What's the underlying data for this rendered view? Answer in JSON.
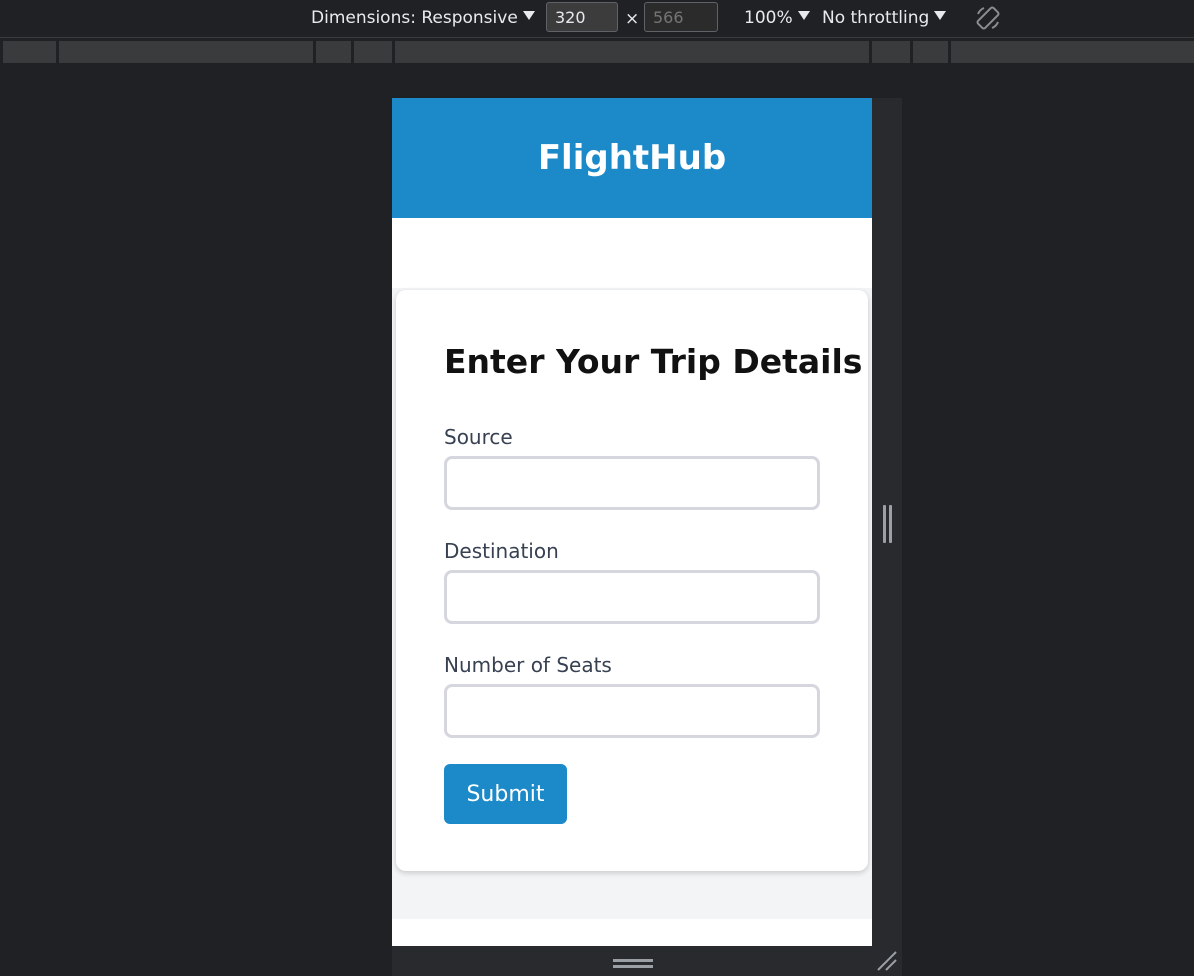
{
  "devtools": {
    "dimensions_label": "Dimensions: Responsive",
    "width_value": "320",
    "height_value": "566",
    "times_symbol": "×",
    "zoom": "100%",
    "throttling": "No throttling"
  },
  "app": {
    "title": "FlightHub",
    "form": {
      "heading": "Enter Your Trip Details",
      "fields": [
        {
          "label": "Source",
          "value": ""
        },
        {
          "label": "Destination",
          "value": ""
        },
        {
          "label": "Number of Seats",
          "value": ""
        }
      ],
      "submit_label": "Submit"
    }
  },
  "colors": {
    "brand": "#1c8ac9",
    "devtools_bg": "#202124"
  }
}
